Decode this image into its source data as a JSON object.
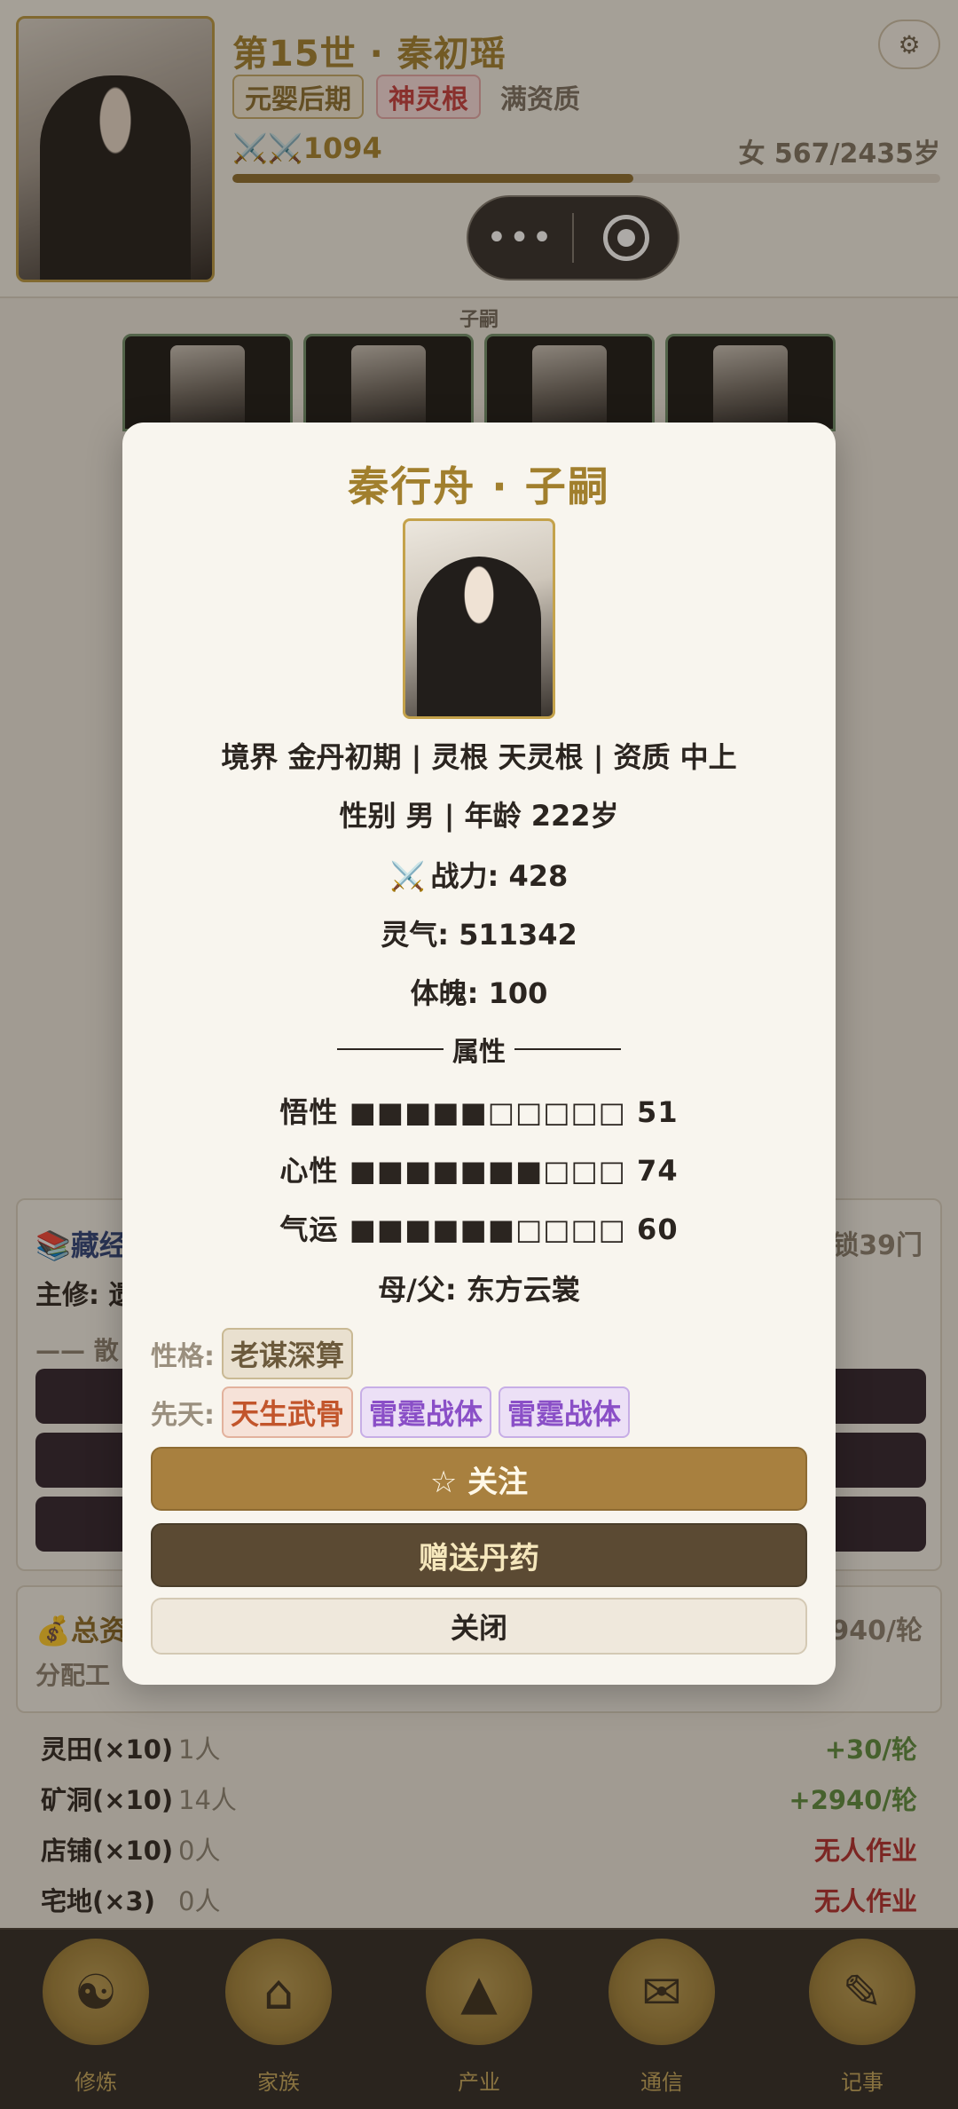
{
  "header": {
    "title": "第15世 · 秦初瑶",
    "realm_tag": "元婴后期",
    "root_tag": "神灵根",
    "aptitude_tag": "满资质",
    "power": "⚔️⚔️1094",
    "gender_age": "女 567/2435岁",
    "lifespan_progress": 0.567,
    "settings_icon": "gear-icon",
    "capsule_more": "•••",
    "capsule_close": "◉"
  },
  "children": {
    "label": "子嗣"
  },
  "scripture": {
    "title": "藏经",
    "main_prefix": "主修: 遗",
    "right_text": "锁39门",
    "sub_text": "—— 散"
  },
  "assets": {
    "title": "总资",
    "right_text": "2940/轮",
    "sub_text": "分配工"
  },
  "production": [
    {
      "name": "灵田(×10)",
      "count": "1人",
      "output": "+30/轮",
      "idle": false
    },
    {
      "name": "矿洞(×10)",
      "count": "14人",
      "output": "+2940/轮",
      "idle": false
    },
    {
      "name": "店铺(×10)",
      "count": "0人",
      "output": "无人作业",
      "idle": true
    },
    {
      "name": "宅地(×3)",
      "count": "0人",
      "output": "无人作业",
      "idle": true
    }
  ],
  "nav": [
    {
      "label": "修炼",
      "icon": "meditation-icon"
    },
    {
      "label": "家族",
      "icon": "house-icon"
    },
    {
      "label": "产业",
      "icon": "mountain-icon"
    },
    {
      "label": "通信",
      "icon": "scholar-icon"
    },
    {
      "label": "记事",
      "icon": "scroll-icon"
    }
  ],
  "modal": {
    "title": "秦行舟 · 子嗣",
    "line1": "境界 金丹初期 | 灵根 天灵根 | 资质 中上",
    "line2": "性别 男 | 年龄 222岁",
    "power_icon": "⚔️",
    "power": "战力: 428",
    "spirit": "灵气: 511342",
    "body": "体魄: 100",
    "section_label": "属性",
    "attributes": [
      {
        "label": "悟性",
        "bar": "■■■■■□□□□□",
        "value": "51"
      },
      {
        "label": "心性",
        "bar": "■■■■■■■□□□",
        "value": "74"
      },
      {
        "label": "气运",
        "bar": "■■■■■■□□□□",
        "value": "60"
      }
    ],
    "parent": "母/父: 东方云裳",
    "personality_label": "性格:",
    "personality": "老谋深算",
    "innate_label": "先天:",
    "innate": [
      "天生武骨",
      "雷霆战体",
      "雷霆战体"
    ],
    "follow_label": "☆ 关注",
    "gift_label": "赠送丹药",
    "close_label": "关闭"
  },
  "colors": {
    "gold": "#a17f2d",
    "red": "#c53a3a",
    "purple": "#8a4fc7",
    "follow_button": "#a8803f",
    "gift_button": "#5b4a33"
  }
}
